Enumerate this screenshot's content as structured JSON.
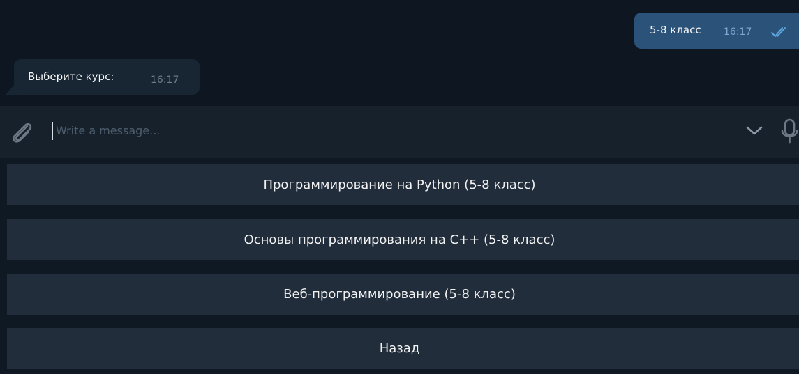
{
  "messages": {
    "outgoing": {
      "text": "5-8 класс",
      "time": "16:17",
      "status_icon": "double-check-icon"
    },
    "incoming": {
      "text": "Выберите курс:",
      "time": "16:17"
    }
  },
  "composer": {
    "placeholder": "Write a message...",
    "value": "",
    "attach_icon": "paperclip-icon",
    "scroll_icon": "chevron-down-icon",
    "voice_icon": "microphone-icon"
  },
  "keyboard": {
    "buttons": [
      "Программирование на Python (5-8 класс)",
      "Основы программирования на С++ (5-8 класс)",
      "Веб-программирование (5-8 класс)",
      "Назад"
    ]
  },
  "colors": {
    "chat_background": "#0e1621",
    "outgoing_bubble": "#2b5278",
    "incoming_bubble": "#182533",
    "input_bar": "#17212b",
    "keyboard_button": "#212d3b",
    "read_check": "#5ea6e0"
  }
}
